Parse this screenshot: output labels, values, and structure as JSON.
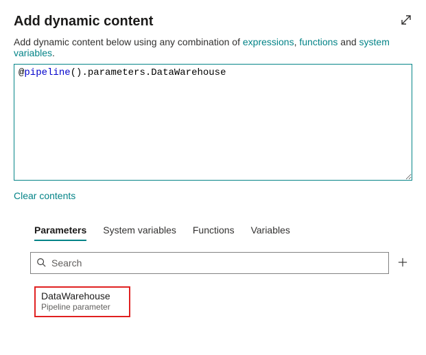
{
  "header": {
    "title": "Add dynamic content"
  },
  "intro": {
    "prefix": "Add dynamic content below using any combination of ",
    "link_expressions": "expressions",
    "sep1": ", ",
    "link_functions": "functions",
    "sep2": " and ",
    "link_system_variables": "system variables",
    "suffix": "."
  },
  "editor": {
    "value_tokens": {
      "at": "@",
      "kw": "pipeline",
      "parens": "()",
      "dot1": ".",
      "prop1": "parameters",
      "dot2": ".",
      "prop2": "DataWarehouse"
    }
  },
  "actions": {
    "clear_contents": "Clear contents"
  },
  "tabs": {
    "items": [
      {
        "label": "Parameters"
      },
      {
        "label": "System variables"
      },
      {
        "label": "Functions"
      },
      {
        "label": "Variables"
      }
    ]
  },
  "search": {
    "placeholder": "Search"
  },
  "parameters_list": {
    "items": [
      {
        "name": "DataWarehouse",
        "description": "Pipeline parameter"
      }
    ]
  }
}
